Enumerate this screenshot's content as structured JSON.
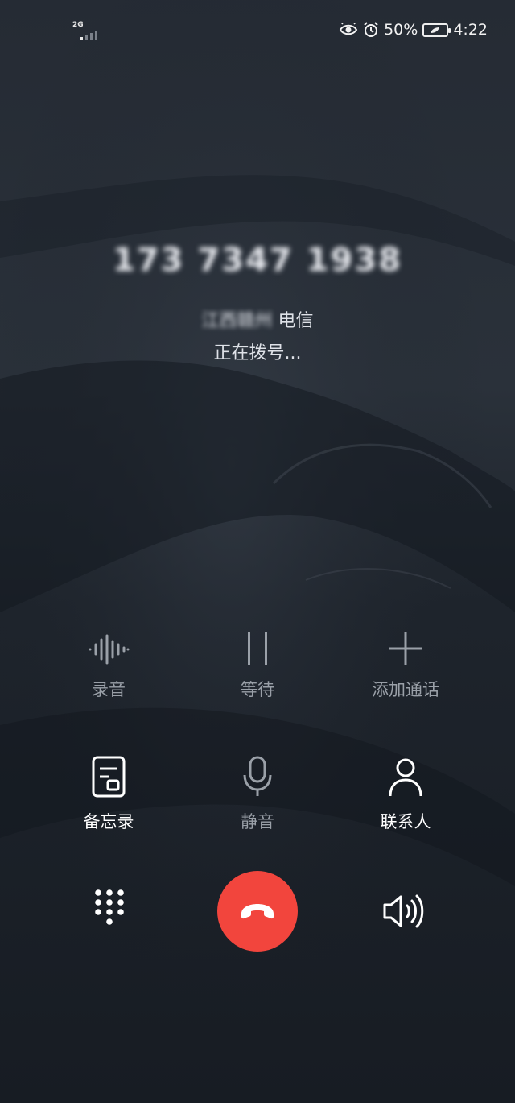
{
  "status_bar": {
    "network": "2G",
    "battery_percent": "50%",
    "time": "4:22",
    "icons": [
      "eye-comfort-icon",
      "alarm-icon",
      "battery-icon"
    ]
  },
  "callee": {
    "number": "173 7347 1938",
    "location_blurred": "江西赣州",
    "location_visible_suffix": "州",
    "carrier": "电信",
    "status": "正在拨号..."
  },
  "controls_row1": [
    {
      "label": "录音",
      "icon": "waveform-icon",
      "enabled": false
    },
    {
      "label": "等待",
      "icon": "pause-icon",
      "enabled": false
    },
    {
      "label": "添加通话",
      "icon": "plus-icon",
      "enabled": false
    }
  ],
  "controls_row2": [
    {
      "label": "备忘录",
      "icon": "memo-icon",
      "enabled": true
    },
    {
      "label": "静音",
      "icon": "microphone-icon",
      "enabled": false
    },
    {
      "label": "联系人",
      "icon": "contact-icon",
      "enabled": true
    }
  ],
  "bottom": {
    "dialpad_icon": "dialpad-icon",
    "end_call_icon": "phone-hangup-icon",
    "end_call_color": "#f2453d",
    "speaker_icon": "speaker-icon"
  }
}
